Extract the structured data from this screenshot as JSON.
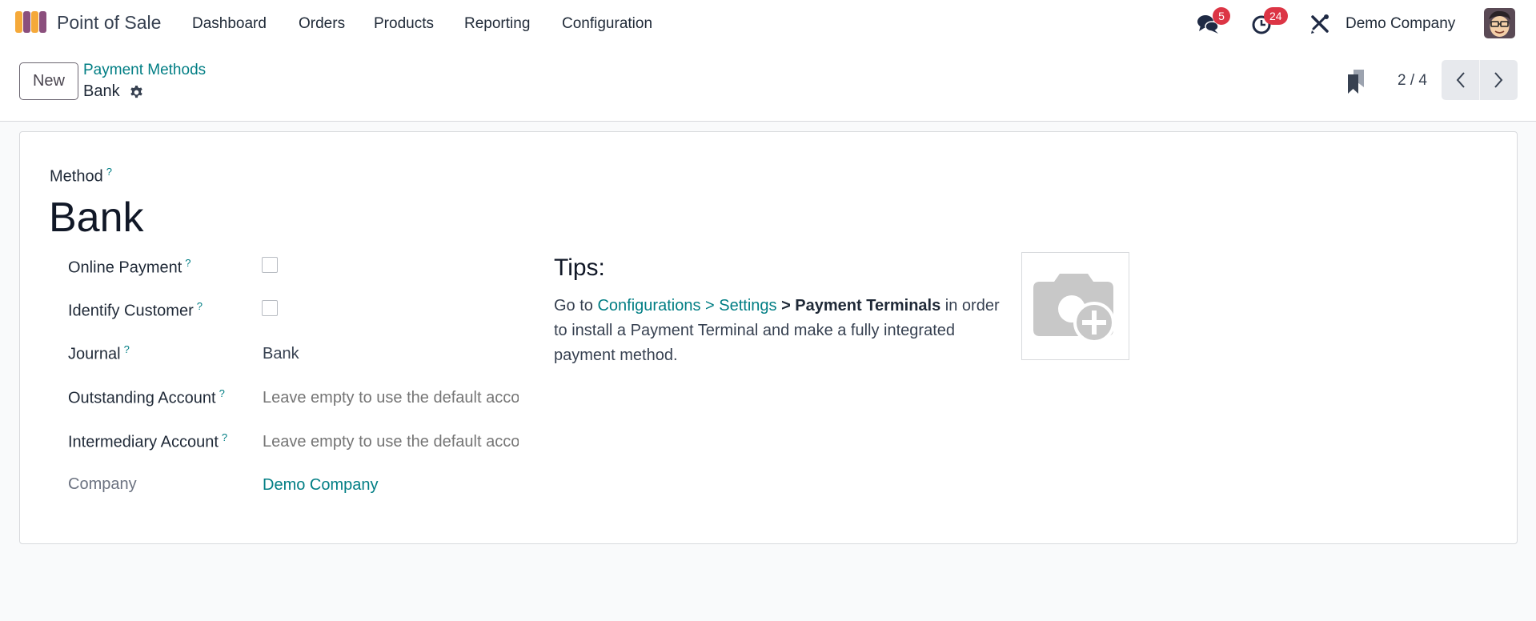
{
  "navbar": {
    "app_name": "Point of Sale",
    "menu": [
      "Dashboard",
      "Orders",
      "Products",
      "Reporting",
      "Configuration"
    ],
    "messages_badge": "5",
    "activities_badge": "24",
    "company": "Demo Company",
    "icons": {
      "app": "pos-app-icon",
      "messages": "chat-bubbles-icon",
      "activities": "clock-icon",
      "debug": "tools-icon",
      "avatar": "user-avatar"
    }
  },
  "control_panel": {
    "new_label": "New",
    "breadcrumb_parent": "Payment Methods",
    "record_name": "Bank",
    "pager_value": "2 / 4"
  },
  "form": {
    "method_label": "Method",
    "help_mark": "?",
    "method_value": "Bank",
    "fields": {
      "online_payment": {
        "label": "Online Payment",
        "checked": false
      },
      "identify_customer": {
        "label": "Identify Customer",
        "checked": false
      },
      "journal": {
        "label": "Journal",
        "value": "Bank"
      },
      "outstanding_account": {
        "label": "Outstanding Account",
        "placeholder": "Leave empty to use the default account from the company setting"
      },
      "intermediary_account": {
        "label": "Intermediary Account",
        "placeholder": "Leave empty to use the default account from the company setting"
      },
      "company": {
        "label": "Company",
        "value": "Demo Company"
      }
    },
    "tips": {
      "title": "Tips:",
      "prefix": "Go to ",
      "link": "Configurations > Settings",
      "bold": " > Payment Terminals",
      "suffix": " in order to install a Payment Terminal and make a fully integrated payment method."
    }
  },
  "colors": {
    "accent": "#017e84",
    "badge": "#dc3545",
    "logo_orange": "#f5a93a",
    "logo_purple": "#8b4f7d"
  }
}
